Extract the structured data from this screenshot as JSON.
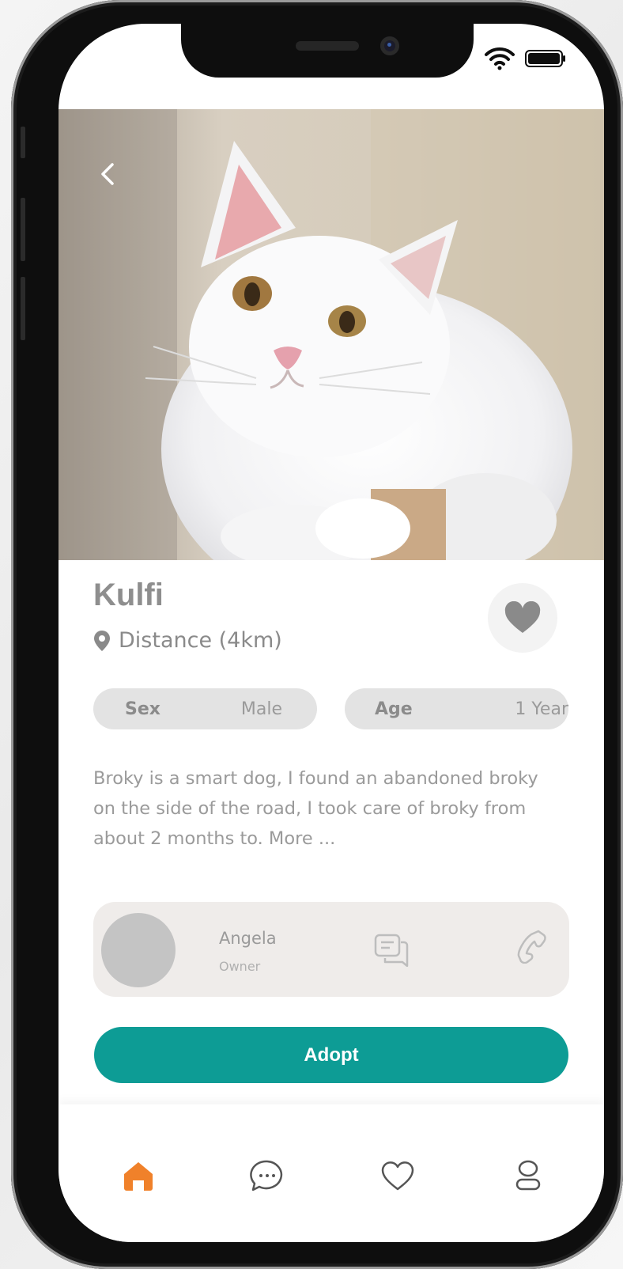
{
  "pet": {
    "name": "Kulfi",
    "distance": "Distance (4km)",
    "sex_label": "Sex",
    "sex_value": "Male",
    "age_label": "Age",
    "age_value": "1 Year",
    "description": "Broky is a smart dog, I found an abandoned broky on the side of the road, I took care of broky from about 2 months to. More ...",
    "photo_alt": "White cat"
  },
  "owner": {
    "name": "Angela",
    "role": "Owner"
  },
  "actions": {
    "adopt_label": "Adopt"
  },
  "icons": {
    "back": "chevron-left-icon",
    "location": "map-pin-icon",
    "favorite": "heart-icon",
    "chat": "message-icon",
    "call": "phone-icon",
    "home": "home-icon",
    "profile": "user-icon"
  },
  "colors": {
    "primary": "#0d9c95",
    "active_tab": "#f0812a",
    "chip_bg": "#e3e3e3",
    "card_bg": "#efecea",
    "muted_text": "#9a9a9a"
  }
}
